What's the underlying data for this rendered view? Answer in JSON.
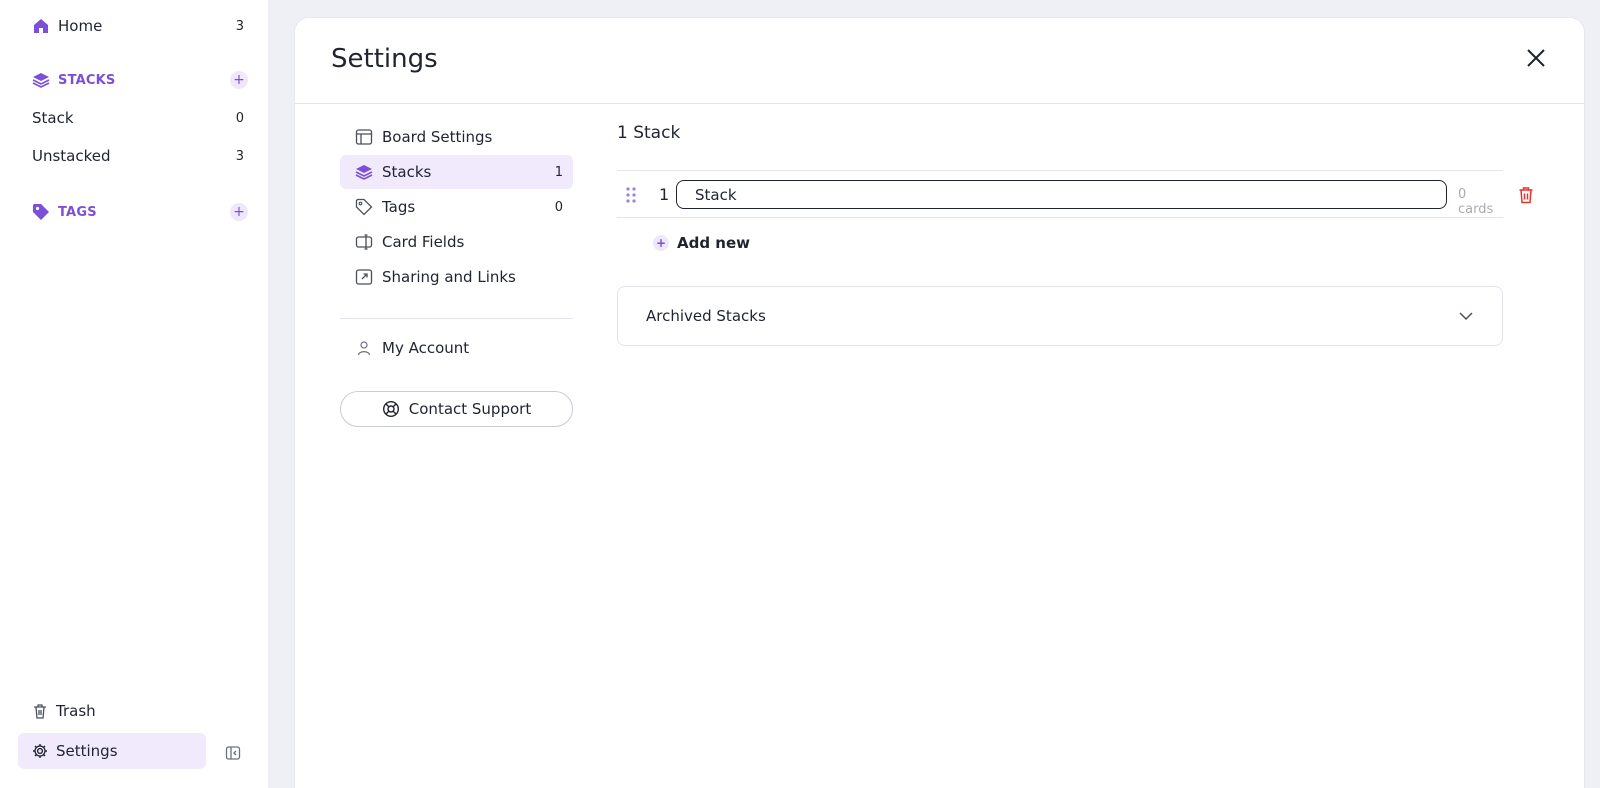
{
  "sidebar": {
    "home": {
      "label": "Home",
      "count": "3"
    },
    "stacks_section": {
      "title": "STACKS"
    },
    "stacks": [
      {
        "label": "Stack",
        "count": "0"
      },
      {
        "label": "Unstacked",
        "count": "3"
      }
    ],
    "tags_section": {
      "title": "TAGS"
    },
    "trash_label": "Trash",
    "settings_label": "Settings"
  },
  "modal": {
    "title": "Settings",
    "nav": [
      {
        "label": "Board Settings",
        "icon": "layout-icon",
        "count": ""
      },
      {
        "label": "Stacks",
        "icon": "layers-icon",
        "count": "1"
      },
      {
        "label": "Tags",
        "icon": "tag-icon",
        "count": "0"
      },
      {
        "label": "Card Fields",
        "icon": "text-field-icon",
        "count": ""
      },
      {
        "label": "Sharing and Links",
        "icon": "external-link-icon",
        "count": ""
      }
    ],
    "my_account_label": "My Account",
    "contact_support_label": "Contact Support",
    "content": {
      "stack_count_title": "1 Stack",
      "rows": [
        {
          "index": "1",
          "name": "Stack",
          "cards": "0 cards"
        }
      ],
      "add_new_label": "Add new",
      "archived_label": "Archived Stacks"
    }
  },
  "colors": {
    "accent": "#7b4fd6",
    "accent_bg": "#f1eafd",
    "danger": "#e5322d",
    "page_bg": "#eef0f5"
  }
}
